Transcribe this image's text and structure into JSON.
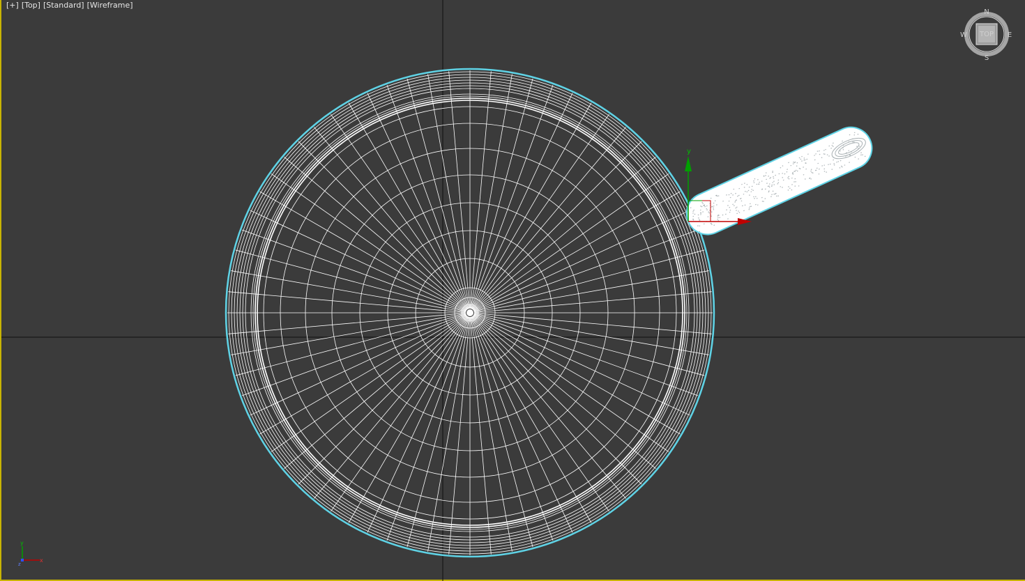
{
  "viewport": {
    "menu_plus": "[+]",
    "view_name": "[Top]",
    "shading_preset": "[Standard]",
    "shading_mode": "[Wireframe]"
  },
  "viewcube": {
    "north": "N",
    "south": "S",
    "east": "E",
    "west": "W",
    "face": "TOP"
  },
  "gizmo": {
    "y_label": "y"
  },
  "axis_tripod": {
    "y_label": "y",
    "x_label": "x",
    "z_label": "z"
  },
  "colors": {
    "background": "#3b3b3b",
    "selection": "#5fd3e6",
    "wire": "#ffffff",
    "x_axis": "#c00000",
    "y_axis": "#00a000",
    "z_axis": "#3050ff",
    "active_border": "#c8b400"
  }
}
